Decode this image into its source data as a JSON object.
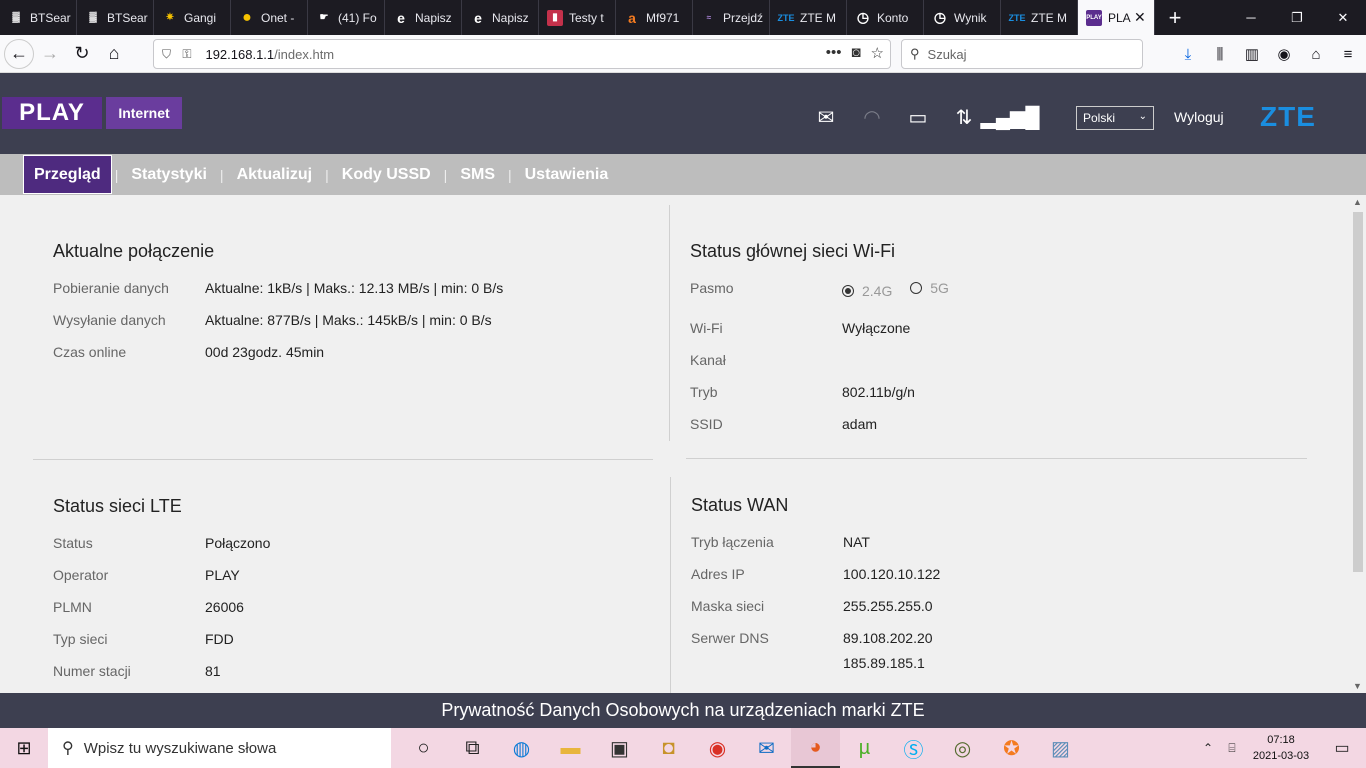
{
  "browser": {
    "tabs": [
      {
        "label": "BTSear",
        "icon": "tower-icon"
      },
      {
        "label": "BTSear",
        "icon": "tower-icon"
      },
      {
        "label": "Gangi",
        "icon": "star-icon"
      },
      {
        "label": "Onet -",
        "icon": "circle-icon"
      },
      {
        "label": "(41) Fo",
        "icon": "hand-icon"
      },
      {
        "label": "Napisz",
        "icon": "edge-icon"
      },
      {
        "label": "Napisz",
        "icon": "edge-icon"
      },
      {
        "label": "Testy t",
        "icon": "bars-icon"
      },
      {
        "label": "Mf971",
        "icon": "a-icon"
      },
      {
        "label": "Przejdź",
        "icon": "play-icon"
      },
      {
        "label": "ZTE M",
        "icon": "zte-icon"
      },
      {
        "label": "Konto",
        "icon": "gauge-icon"
      },
      {
        "label": "Wynik",
        "icon": "gauge-icon"
      },
      {
        "label": "ZTE M",
        "icon": "zte-icon"
      },
      {
        "label": "PLA",
        "icon": "play-icon",
        "active": true
      }
    ],
    "url_host": "192.168.1.1",
    "url_path": "/index.htm",
    "search_placeholder": "Szukaj"
  },
  "header": {
    "logo_play": "PLAY",
    "logo_internet": "Internet",
    "language": "Polski",
    "logout": "Wyloguj",
    "brand": "ZTE"
  },
  "menu": [
    "Przegląd",
    "Statystyki",
    "Aktualizuj",
    "Kody USSD",
    "SMS",
    "Ustawienia"
  ],
  "connection": {
    "title": "Aktualne połączenie",
    "rows": [
      {
        "label": "Pobieranie danych",
        "value": "Aktualne: 1kB/s | Maks.: 12.13 MB/s | min: 0 B/s"
      },
      {
        "label": "Wysyłanie danych",
        "value": "Aktualne: 877B/s | Maks.: 145kB/s | min: 0 B/s"
      },
      {
        "label": "Czas online",
        "value": "00d 23godz. 45min"
      }
    ]
  },
  "wifi": {
    "title": "Status głównej sieci Wi-Fi",
    "band_label": "Pasmo",
    "band_options": [
      "2.4G",
      "5G"
    ],
    "rows": [
      {
        "label": "Wi-Fi",
        "value": "Wyłączone"
      },
      {
        "label": "Kanał",
        "value": ""
      },
      {
        "label": "Tryb",
        "value": "802.11b/g/n"
      },
      {
        "label": "SSID",
        "value": "adam"
      }
    ]
  },
  "lte": {
    "title": "Status sieci LTE",
    "rows": [
      {
        "label": "Status",
        "value": "Połączono"
      },
      {
        "label": "Operator",
        "value": "PLAY"
      },
      {
        "label": "PLMN",
        "value": "26006"
      },
      {
        "label": "Typ sieci",
        "value": "FDD"
      },
      {
        "label": "Numer stacji",
        "value": "81"
      }
    ]
  },
  "wan": {
    "title": "Status WAN",
    "rows": [
      {
        "label": "Tryb łączenia",
        "value": "NAT"
      },
      {
        "label": "Adres IP",
        "value": "100.120.10.122"
      },
      {
        "label": "Maska sieci",
        "value": "255.255.255.0"
      },
      {
        "label": "Serwer DNS",
        "value": "89.108.202.20"
      },
      {
        "label": "",
        "value": "185.89.185.1"
      }
    ]
  },
  "footer": "Prywatność Danych Osobowych na urządzeniach marki ZTE",
  "taskbar": {
    "search_placeholder": "Wpisz tu wyszukiwane słowa",
    "time": "07:18",
    "date": "2021-03-03"
  }
}
